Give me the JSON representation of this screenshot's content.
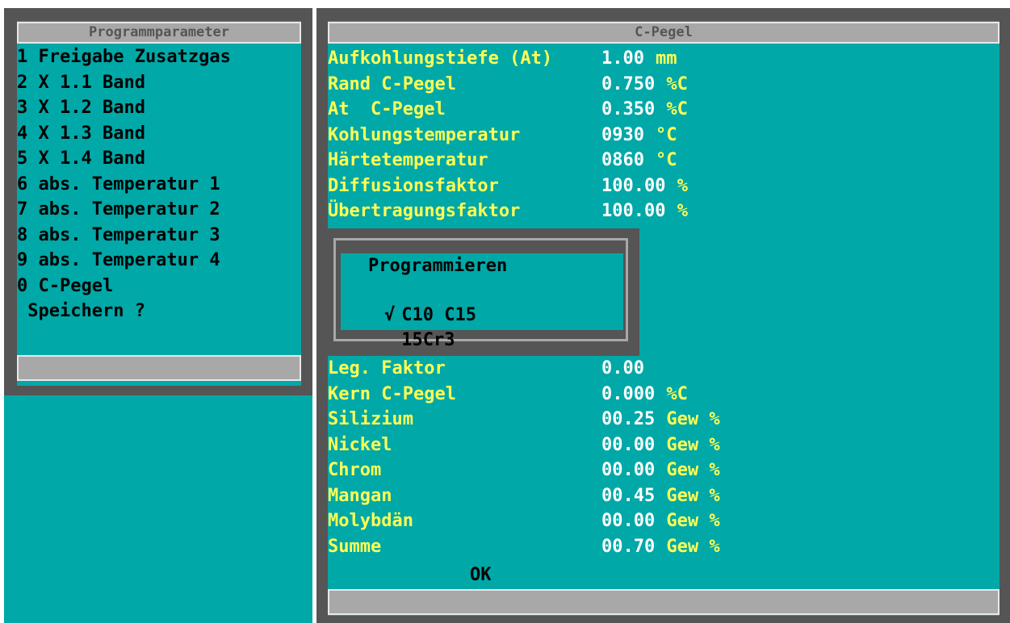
{
  "left_panel": {
    "title": "Programmparameter",
    "items": [
      {
        "label": "1 Freigabe Zusatzgas"
      },
      {
        "label": "2 X 1.1 Band"
      },
      {
        "label": "3 X 1.2 Band"
      },
      {
        "label": "4 X 1.3 Band"
      },
      {
        "label": "5 X 1.4 Band"
      },
      {
        "label": "6 abs. Temperatur 1"
      },
      {
        "label": "7 abs. Temperatur 2"
      },
      {
        "label": "8 abs. Temperatur 3"
      },
      {
        "label": "9 abs. Temperatur 4"
      },
      {
        "label": "0 C-Pegel"
      }
    ],
    "save": " Speichern ?"
  },
  "right_panel": {
    "title": "C-Pegel",
    "params_top": [
      {
        "label": "Aufkohlungstiefe (At)",
        "value": "1.00",
        "unit": "mm"
      },
      {
        "label": "Rand C-Pegel",
        "value": "0.750",
        "unit": "%C"
      },
      {
        "label": "At  C-Pegel",
        "value": "0.350",
        "unit": "%C"
      },
      {
        "label": "Kohlungstemperatur",
        "value": "0930",
        "unit": "°C"
      },
      {
        "label": "Härtetemperatur",
        "value": "0860",
        "unit": "°C"
      },
      {
        "label": "Diffusionsfaktor",
        "value": "100.00",
        "unit": "%"
      },
      {
        "label": "Übertragungsfaktor",
        "value": "100.00",
        "unit": "%"
      }
    ],
    "params_bottom": [
      {
        "label": "Leg. Faktor",
        "value": "0.00",
        "unit": ""
      },
      {
        "label": "Kern C-Pegel",
        "value": "0.000",
        "unit": "%C"
      },
      {
        "label": "Silizium",
        "value": "00.25",
        "unit": "Gew %"
      },
      {
        "label": "Nickel",
        "value": "00.00",
        "unit": "Gew %"
      },
      {
        "label": "Chrom",
        "value": "00.00",
        "unit": "Gew %"
      },
      {
        "label": "Mangan",
        "value": "00.45",
        "unit": "Gew %"
      },
      {
        "label": "Molybdän",
        "value": "00.00",
        "unit": "Gew %"
      },
      {
        "label": "Summe",
        "value": "00.70",
        "unit": "Gew %"
      }
    ],
    "ok_label": "OK"
  },
  "popup": {
    "title": "Programmieren",
    "check_mark": "√",
    "options": [
      {
        "label": "C10 C15",
        "selected": true
      },
      {
        "label": "15Cr3",
        "selected": false
      }
    ]
  },
  "colors": {
    "teal": "#00a8a8",
    "frame": "#555555",
    "yellow": "#ffff55",
    "gray": "#a8a8a8"
  }
}
